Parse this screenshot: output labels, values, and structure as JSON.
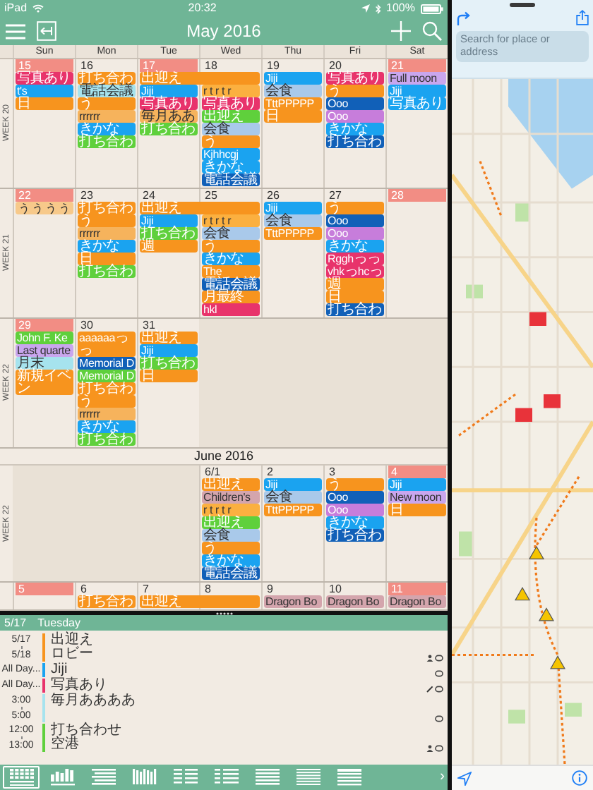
{
  "status_bar": {
    "device": "iPad",
    "time": "20:32",
    "battery": "100%"
  },
  "header": {
    "title": "May 2016"
  },
  "weekdays": [
    "Sun",
    "Mon",
    "Tue",
    "Wed",
    "Thu",
    "Fri",
    "Sat"
  ],
  "calendar": [
    {
      "kind": "week",
      "label": "WEEK 20",
      "days": [
        {
          "date": "15",
          "highlighted": true,
          "events": [
            {
              "text": "写真あり",
              "color": "#e8336b"
            },
            {
              "text": "t's",
              "color": "#1aa3f0"
            },
            {
              "text": "日",
              "color": "#f7941e"
            }
          ]
        },
        {
          "date": "16",
          "highlighted": false,
          "events": [
            {
              "text": "打ち合わ",
              "color": "#f7941e"
            },
            {
              "text": "電話会議",
              "color": "#a6e3ee"
            },
            {
              "text": "う",
              "color": "#f7941e"
            },
            {
              "text": "rrrrrr",
              "color": "#f6b35c"
            },
            {
              "text": "きかな",
              "color": "#1aa3f0"
            },
            {
              "text": "打ち合わ",
              "color": "#5fd03c"
            }
          ]
        },
        {
          "date": "17",
          "highlighted": true,
          "events": [
            {
              "text": "出迎え",
              "color": "#f7941e",
              "spans_next_day": true
            },
            {
              "text": "Jiji",
              "color": "#1aa3f0"
            },
            {
              "text": "写真あり",
              "color": "#e8336b"
            },
            {
              "text": "毎月ああ",
              "color": "#f6b35c"
            },
            {
              "text": "打ち合わ",
              "color": "#5fd03c"
            }
          ]
        },
        {
          "date": "18",
          "highlighted": false,
          "events": [
            {
              "text": "r t r t r",
              "color": "#fbb040"
            },
            {
              "text": "写真あり",
              "color": "#e8336b"
            },
            {
              "text": "出迎え",
              "color": "#5fd03c"
            },
            {
              "text": "会食",
              "color": "#a9c9ea"
            },
            {
              "text": "う",
              "color": "#f7941e"
            },
            {
              "text": "Kjhhcgj",
              "color": "#1aa3f0"
            },
            {
              "text": "きかな",
              "color": "#1aa3f0"
            },
            {
              "text": "電話会議",
              "color": "#1160b8"
            }
          ]
        },
        {
          "date": "19",
          "highlighted": false,
          "events": [
            {
              "text": "Jiji",
              "color": "#1aa3f0"
            },
            {
              "text": "会食",
              "color": "#a9c9ea"
            },
            {
              "text": "TttPPPPP",
              "color": "#f7941e"
            },
            {
              "text": "日",
              "color": "#f7941e"
            }
          ]
        },
        {
          "date": "20",
          "highlighted": false,
          "events": [
            {
              "text": "写真あり",
              "color": "#e8336b"
            },
            {
              "text": "う",
              "color": "#f7941e"
            },
            {
              "text": "Ooo",
              "color": "#1160b8"
            },
            {
              "text": "Ooo",
              "color": "#c77ddb"
            },
            {
              "text": "きかな",
              "color": "#1aa3f0"
            },
            {
              "text": "打ち合わ",
              "color": "#1160b8"
            }
          ]
        },
        {
          "date": "21",
          "highlighted": true,
          "events": [
            {
              "text": "Full moon",
              "color": "#c9a6ee"
            },
            {
              "text": "Jiji",
              "color": "#1aa3f0"
            },
            {
              "text": "写真あり",
              "color": "#1aa3f0"
            }
          ]
        }
      ]
    },
    {
      "kind": "week",
      "label": "WEEK 21",
      "days": [
        {
          "date": "22",
          "highlighted": true,
          "events": [
            {
              "text": "ぅぅぅぅ",
              "color": "#f7c98a"
            }
          ]
        },
        {
          "date": "23",
          "highlighted": false,
          "events": [
            {
              "text": "打ち合わ",
              "color": "#f7941e"
            },
            {
              "text": "う",
              "color": "#f7941e"
            },
            {
              "text": "rrrrrr",
              "color": "#f6b35c"
            },
            {
              "text": "きかな",
              "color": "#1aa3f0"
            },
            {
              "text": "日",
              "color": "#f7941e"
            },
            {
              "text": "打ち合わ",
              "color": "#5fd03c"
            }
          ]
        },
        {
          "date": "24",
          "highlighted": false,
          "events": [
            {
              "text": "出迎え",
              "color": "#f7941e",
              "spans_next_day": true
            },
            {
              "text": "Jiji",
              "color": "#1aa3f0"
            },
            {
              "text": "打ち合わ",
              "color": "#5fd03c"
            },
            {
              "text": "週",
              "color": "#f7941e"
            }
          ]
        },
        {
          "date": "25",
          "highlighted": false,
          "events": [
            {
              "text": "r t r t r",
              "color": "#fbb040"
            },
            {
              "text": "会食",
              "color": "#a9c9ea"
            },
            {
              "text": "う",
              "color": "#f7941e"
            },
            {
              "text": "きかな",
              "color": "#1aa3f0"
            },
            {
              "text": "The",
              "color": "#f7941e"
            },
            {
              "text": "電話会議",
              "color": "#1160b8"
            },
            {
              "text": "月最終",
              "color": "#f7941e"
            },
            {
              "text": "hkl",
              "color": "#e8336b"
            }
          ]
        },
        {
          "date": "26",
          "highlighted": false,
          "events": [
            {
              "text": "Jiji",
              "color": "#1aa3f0"
            },
            {
              "text": "会食",
              "color": "#a9c9ea"
            },
            {
              "text": "TttPPPPP",
              "color": "#f7941e"
            }
          ]
        },
        {
          "date": "27",
          "highlighted": false,
          "events": [
            {
              "text": "う",
              "color": "#f7941e"
            },
            {
              "text": "Ooo",
              "color": "#1160b8"
            },
            {
              "text": "Ooo",
              "color": "#c77ddb"
            },
            {
              "text": "きかな",
              "color": "#1aa3f0"
            },
            {
              "text": "Rgghっっ",
              "color": "#e8336b"
            },
            {
              "text": "vhkっhcっ",
              "color": "#e8336b"
            },
            {
              "text": "週",
              "color": "#f7941e"
            },
            {
              "text": "日",
              "color": "#f7941e"
            },
            {
              "text": "打ち合わ",
              "color": "#1160b8"
            }
          ]
        },
        {
          "date": "28",
          "highlighted": true
        }
      ]
    },
    {
      "kind": "week",
      "label": "WEEK 22",
      "days": [
        {
          "date": "29",
          "highlighted": true,
          "events": [
            {
              "text": "John F. Ke",
              "color": "#5fd03c"
            },
            {
              "text": "Last quarte",
              "color": "#c9a6ee"
            },
            {
              "text": "月末",
              "color": "#a6e3ee"
            },
            {
              "text": "新規イベン",
              "color": "#f7941e"
            }
          ]
        },
        {
          "date": "30",
          "highlighted": false,
          "events": [
            {
              "text": "aaaaaaっっ",
              "color": "#f7941e"
            },
            {
              "text": "Memorial D",
              "color": "#1160b8"
            },
            {
              "text": "Memorial D",
              "color": "#5fd03c"
            },
            {
              "text": "打ち合わ",
              "color": "#f7941e"
            },
            {
              "text": "う",
              "color": "#f7941e"
            },
            {
              "text": "rrrrrr",
              "color": "#f6b35c"
            },
            {
              "text": "きかな",
              "color": "#1aa3f0"
            },
            {
              "text": "打ち合わ",
              "color": "#5fd03c"
            }
          ]
        },
        {
          "date": "31",
          "highlighted": false,
          "events": [
            {
              "text": "出迎え",
              "color": "#f7941e"
            },
            {
              "text": "Jiji",
              "color": "#1aa3f0"
            },
            {
              "text": "打ち合わ",
              "color": "#5fd03c"
            },
            {
              "text": "日",
              "color": "#f7941e"
            }
          ]
        },
        {
          "blank": true
        },
        {
          "blank": true
        },
        {
          "blank": true
        },
        {
          "blank": true
        }
      ]
    },
    {
      "kind": "month_header",
      "title": "June 2016"
    },
    {
      "kind": "week",
      "label": "WEEK 22",
      "days": [
        {
          "blank": true
        },
        {
          "blank": true
        },
        {
          "blank": true
        },
        {
          "date": "6/1",
          "highlighted": false,
          "events": [
            {
              "text": "出迎え",
              "color": "#f7941e"
            },
            {
              "text": "Children's",
              "color": "#d4a5ad"
            },
            {
              "text": "r t r t r",
              "color": "#fbb040"
            },
            {
              "text": "出迎え",
              "color": "#5fd03c"
            },
            {
              "text": "会食",
              "color": "#a9c9ea"
            },
            {
              "text": "う",
              "color": "#f7941e"
            },
            {
              "text": "きかな",
              "color": "#1aa3f0"
            },
            {
              "text": "電話会議",
              "color": "#1160b8"
            }
          ]
        },
        {
          "date": "2",
          "highlighted": false,
          "events": [
            {
              "text": "Jiji",
              "color": "#1aa3f0"
            },
            {
              "text": "会食",
              "color": "#a9c9ea"
            },
            {
              "text": "TttPPPPP",
              "color": "#f7941e"
            }
          ]
        },
        {
          "date": "3",
          "highlighted": false,
          "events": [
            {
              "text": "う",
              "color": "#f7941e"
            },
            {
              "text": "Ooo",
              "color": "#1160b8"
            },
            {
              "text": "Ooo",
              "color": "#c77ddb"
            },
            {
              "text": "きかな",
              "color": "#1aa3f0"
            },
            {
              "text": "打ち合わ",
              "color": "#1160b8"
            }
          ]
        },
        {
          "date": "4",
          "highlighted": true,
          "events": [
            {
              "text": "Jiji",
              "color": "#1aa3f0"
            },
            {
              "text": "New moon",
              "color": "#c9a6ee"
            },
            {
              "text": "日",
              "color": "#f7941e"
            }
          ]
        }
      ]
    },
    {
      "kind": "week",
      "days": [
        {
          "date": "5",
          "highlighted": true
        },
        {
          "date": "6",
          "highlighted": false,
          "events": [
            {
              "text": "打ち合わ",
              "color": "#f7941e"
            }
          ]
        },
        {
          "date": "7",
          "highlighted": false,
          "events": [
            {
              "text": "出迎え",
              "color": "#f7941e",
              "spans_next_day": true
            }
          ]
        },
        {
          "date": "8",
          "highlighted": false
        },
        {
          "date": "9",
          "highlighted": false,
          "events": [
            {
              "text": "Dragon Bo",
              "color": "#d4a5ad"
            }
          ]
        },
        {
          "date": "10",
          "highlighted": false,
          "events": [
            {
              "text": "Dragon Bo",
              "color": "#d4a5ad"
            }
          ]
        },
        {
          "date": "11",
          "highlighted": true,
          "events": [
            {
              "text": "Dragon Bo",
              "color": "#d4a5ad"
            }
          ]
        }
      ]
    }
  ],
  "agenda": {
    "date": "5/17",
    "weekday": "Tuesday",
    "items": [
      {
        "start": "5/17",
        "end": "5/18",
        "title": "出迎え",
        "location": "ロビー",
        "color": "#f7941e",
        "has_attendees": true,
        "has_note": false
      },
      {
        "start": "All Day...",
        "title": "Jiji",
        "color": "#1aa3f0",
        "has_attendees": false,
        "has_note": false
      },
      {
        "start": "All Day...",
        "title": "写真あり",
        "color": "#e8336b",
        "has_attendees": false,
        "has_note": true
      },
      {
        "start": "3:00",
        "end": "5:00",
        "title": "毎月ああああ",
        "color": "#a6e3ee",
        "has_attendees": false,
        "has_note": false
      },
      {
        "start": "12:00",
        "end": "13:00",
        "title": "打ち合わせ",
        "location": "空港",
        "color": "#5fd03c",
        "has_attendees": true,
        "has_note": false
      }
    ]
  },
  "view_bar": {
    "views": [
      {
        "kind": "month",
        "selected": true
      },
      {
        "kind": "week",
        "selected": false
      },
      {
        "kind": "list",
        "selected": false
      },
      {
        "kind": "days",
        "selected": false
      },
      {
        "kind": "agenda",
        "selected": false
      },
      {
        "kind": "split",
        "selected": false
      },
      {
        "kind": "day",
        "selected": false
      },
      {
        "kind": "lines",
        "selected": false
      },
      {
        "kind": "page",
        "selected": false
      }
    ],
    "more": "›"
  },
  "map": {
    "search": {
      "placeholder": "Search for place or address"
    }
  }
}
